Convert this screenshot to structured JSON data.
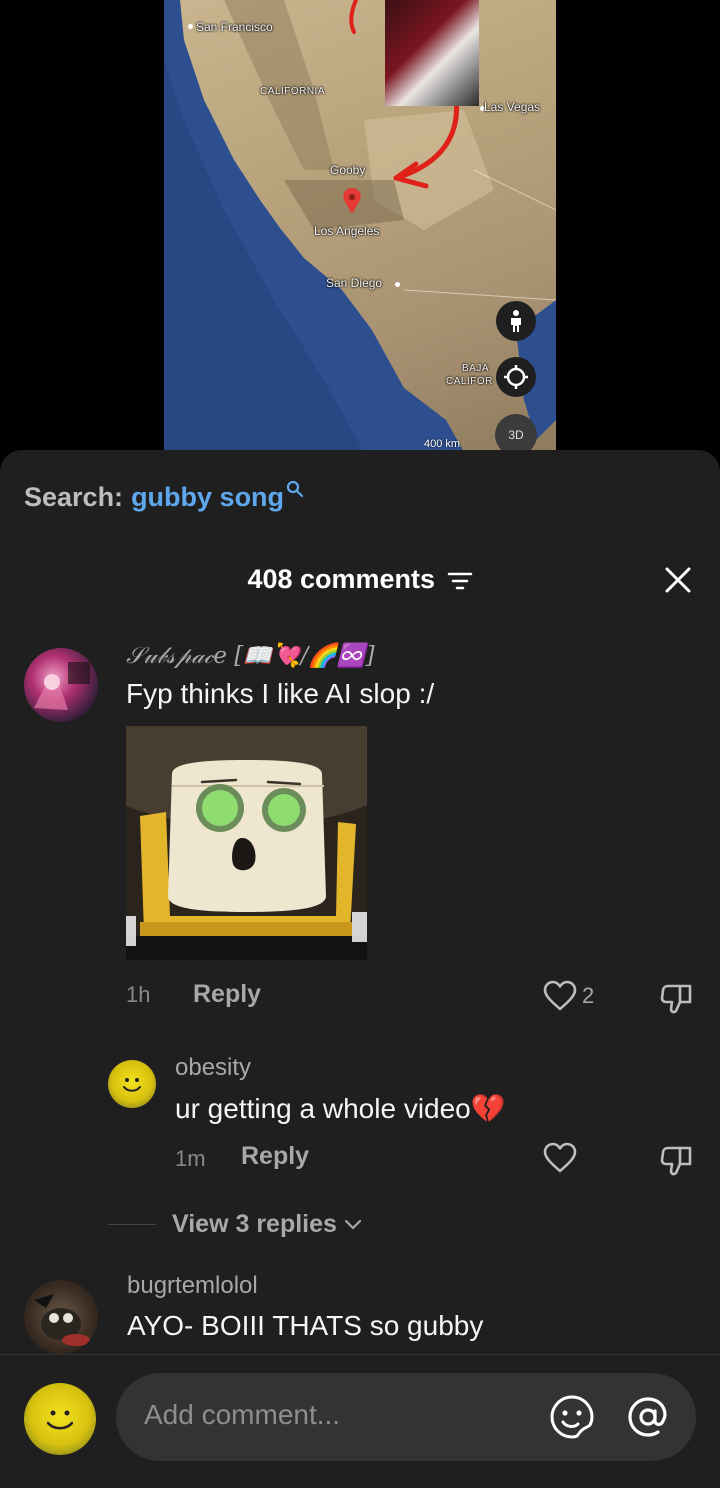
{
  "map": {
    "labels": {
      "san_francisco": "San Francisco",
      "california": "CALIFORNIA",
      "las_vegas": "Las Vegas",
      "gooby": "Gooby",
      "los_angeles": "Los Angeles",
      "san_diego": "San Diego",
      "baja": "BAJA",
      "califor": "CALIFOR",
      "scale": "400 km"
    },
    "button_3d": "3D",
    "pin_color": "#e53935",
    "arrow_color": "#e0211a"
  },
  "search": {
    "prefix": "Search:",
    "term": "gubby song"
  },
  "header": {
    "count_label": "408 comments"
  },
  "comments": [
    {
      "username": "𝒮𝓊𝒷𝓈𝓅𝒶𝒸𝑒 [📖💘/🌈♾️]",
      "text": "Fyp thinks I like AI slop :/",
      "time": "1h",
      "reply_label": "Reply",
      "likes": "2"
    },
    {
      "username": "obesity",
      "text": "ur getting a whole video💔",
      "time": "1m",
      "reply_label": "Reply",
      "likes": ""
    },
    {
      "username": "bugrtemlolol",
      "text": "AYO- BOIII THATS so gubby"
    }
  ],
  "view_replies": {
    "label": "View 3 replies"
  },
  "input": {
    "placeholder": "Add comment..."
  },
  "colors": {
    "sheet_bg": "#1f1f1f",
    "accent_link": "#5fa7ec",
    "muted_text": "#a8a8a8"
  }
}
